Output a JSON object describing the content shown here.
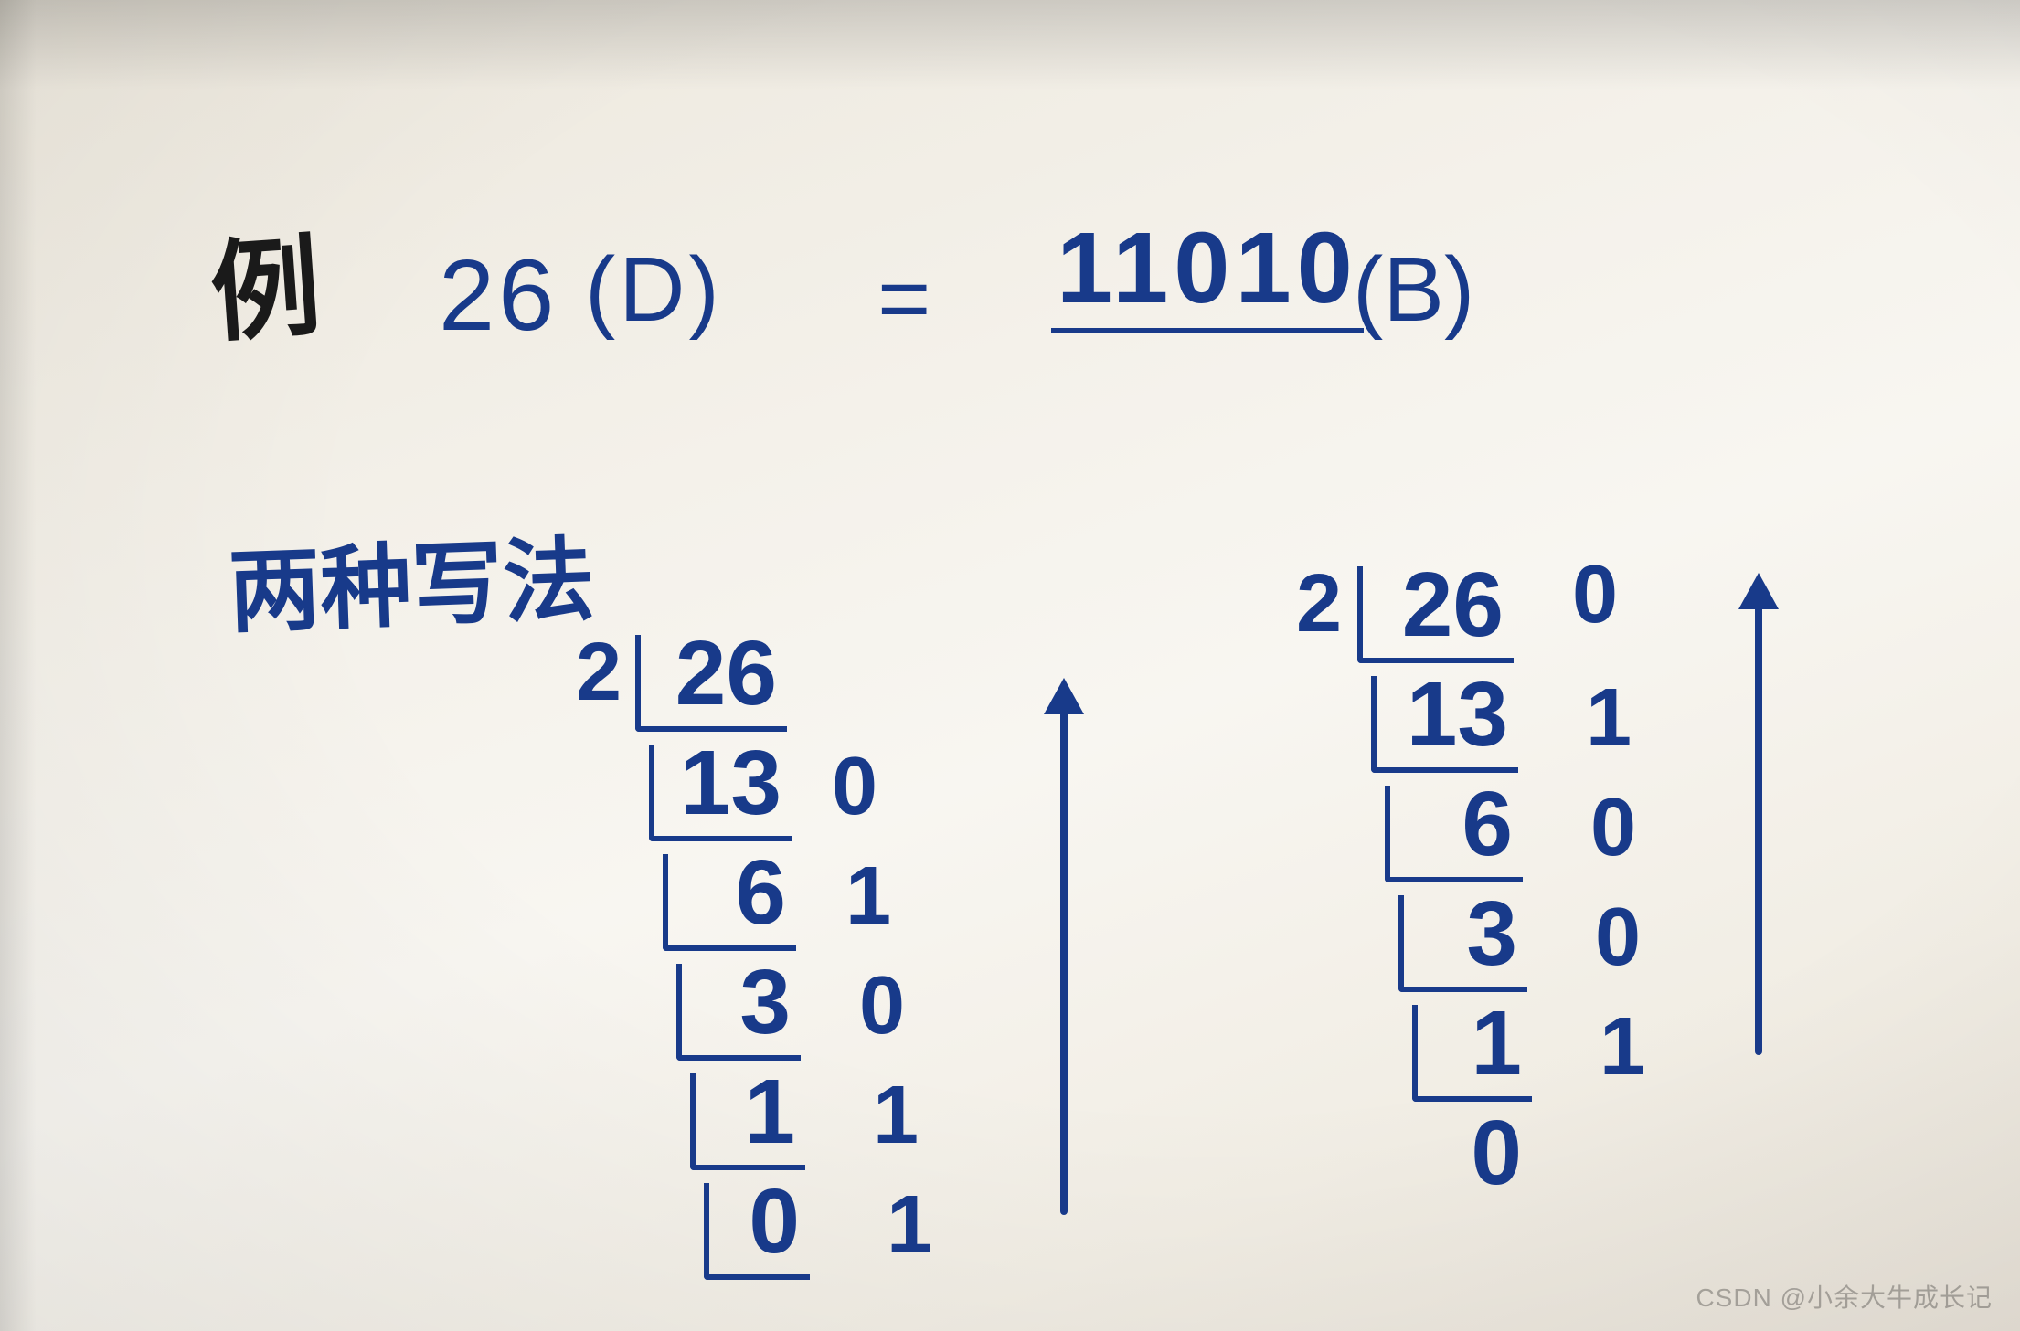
{
  "header": {
    "example_label": "例",
    "decimal_value": "26",
    "decimal_suffix": "(D)",
    "equals": "=",
    "binary_answer": "11010",
    "binary_suffix": "(B)"
  },
  "subtitle": "两种写法",
  "method1": {
    "divisor": "2",
    "rows": [
      {
        "q": "26",
        "r": ""
      },
      {
        "q": "13",
        "r": "0"
      },
      {
        "q": "6",
        "r": "1"
      },
      {
        "q": "3",
        "r": "0"
      },
      {
        "q": "1",
        "r": "1"
      },
      {
        "q": "0",
        "r": "1"
      }
    ]
  },
  "method2": {
    "divisor": "2",
    "rows": [
      {
        "q": "26",
        "r": "0"
      },
      {
        "q": "13",
        "r": "1"
      },
      {
        "q": "6",
        "r": "0"
      },
      {
        "q": "3",
        "r": "0"
      },
      {
        "q": "1",
        "r": "1"
      },
      {
        "q": "0",
        "r": ""
      }
    ]
  },
  "watermark": "CSDN @小余大牛成长记"
}
